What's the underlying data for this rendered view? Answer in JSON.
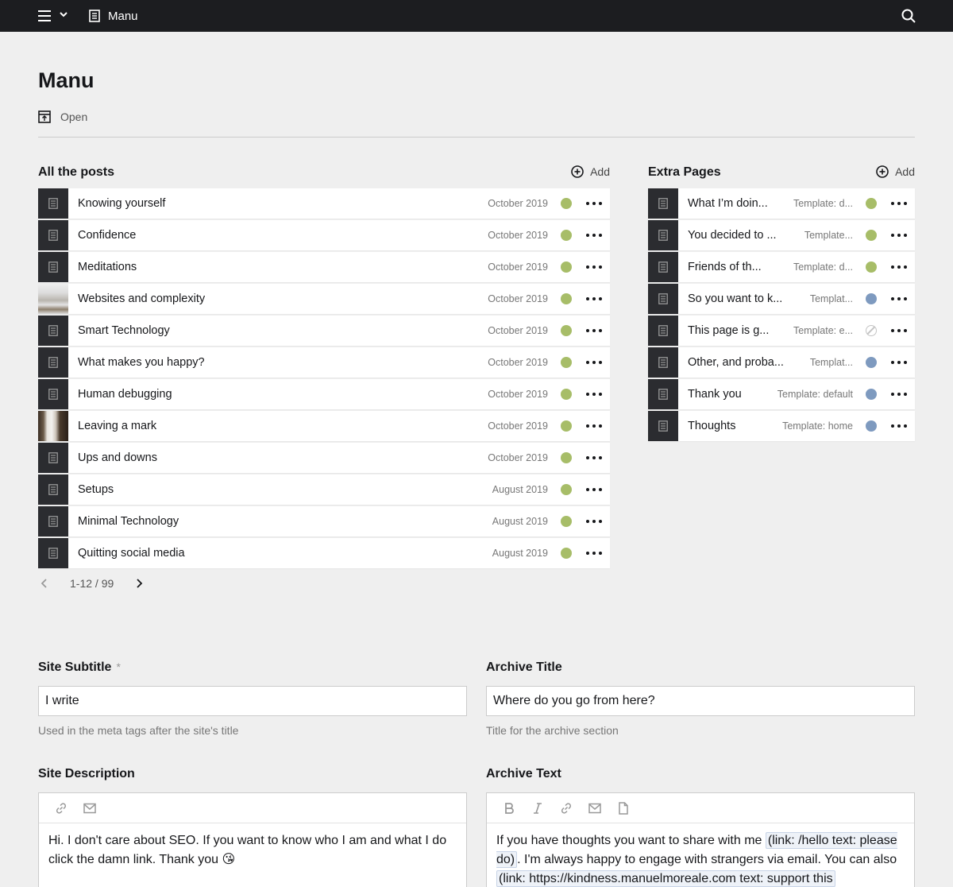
{
  "topbar": {
    "breadcrumb_label": "Manu"
  },
  "header": {
    "title": "Manu",
    "open_label": "Open"
  },
  "posts": {
    "title": "All the posts",
    "add_label": "Add",
    "items": [
      {
        "title": "Knowing yourself",
        "date": "October 2019",
        "thumb": "icon"
      },
      {
        "title": "Confidence",
        "date": "October 2019",
        "thumb": "icon"
      },
      {
        "title": "Meditations",
        "date": "October 2019",
        "thumb": "icon"
      },
      {
        "title": "Websites and complexity",
        "date": "October 2019",
        "thumb": "photo1"
      },
      {
        "title": "Smart Technology",
        "date": "October 2019",
        "thumb": "icon"
      },
      {
        "title": "What makes you happy?",
        "date": "October 2019",
        "thumb": "icon"
      },
      {
        "title": "Human debugging",
        "date": "October 2019",
        "thumb": "icon"
      },
      {
        "title": "Leaving a mark",
        "date": "October 2019",
        "thumb": "photo2"
      },
      {
        "title": "Ups and downs",
        "date": "October 2019",
        "thumb": "icon"
      },
      {
        "title": "Setups",
        "date": "August 2019",
        "thumb": "icon"
      },
      {
        "title": "Minimal Technology",
        "date": "August 2019",
        "thumb": "icon"
      },
      {
        "title": "Quitting social media",
        "date": "August 2019",
        "thumb": "icon"
      }
    ],
    "pagination": "1-12 / 99"
  },
  "pages": {
    "title": "Extra Pages",
    "add_label": "Add",
    "items": [
      {
        "title": "What I’m doin...",
        "template": "Template: d...",
        "status": "listed"
      },
      {
        "title": "You decided to ...",
        "template": "Template...",
        "status": "listed"
      },
      {
        "title": "Friends of th...",
        "template": "Template: d...",
        "status": "listed"
      },
      {
        "title": "So you want to k...",
        "template": "Templat...",
        "status": "unlisted"
      },
      {
        "title": "This page is g...",
        "template": "Template: e...",
        "status": "draft"
      },
      {
        "title": "Other, and proba...",
        "template": "Templat...",
        "status": "unlisted"
      },
      {
        "title": "Thank you",
        "template": "Template: default",
        "status": "unlisted"
      },
      {
        "title": "Thoughts",
        "template": "Template: home",
        "status": "unlisted"
      }
    ]
  },
  "fields": {
    "site_subtitle": {
      "label": "Site Subtitle",
      "required_mark": "*",
      "value": "I write",
      "help": "Used in the meta tags after the site's title"
    },
    "archive_title": {
      "label": "Archive Title",
      "value": "Where do you go from here?",
      "help": "Title for the archive section"
    },
    "site_description": {
      "label": "Site Description",
      "text": "Hi. I don't care about SEO. If you want to know who I am and what I do click the damn link. Thank you 😘"
    },
    "archive_text": {
      "label": "Archive Text",
      "text_1": "If you have thoughts you want to share with me ",
      "tag_1": "(link: /hello text: please do)",
      "text_2": ". I'm always happy to engage with strangers via email. You can also ",
      "tag_2": "(link: https://kindness.manuelmoreale.com text: support this"
    }
  },
  "colors": {
    "topbar_bg": "#1c1d20",
    "page_bg": "#efefef",
    "status_listed": "#a7bd68",
    "status_unlisted": "#7e9abf"
  }
}
